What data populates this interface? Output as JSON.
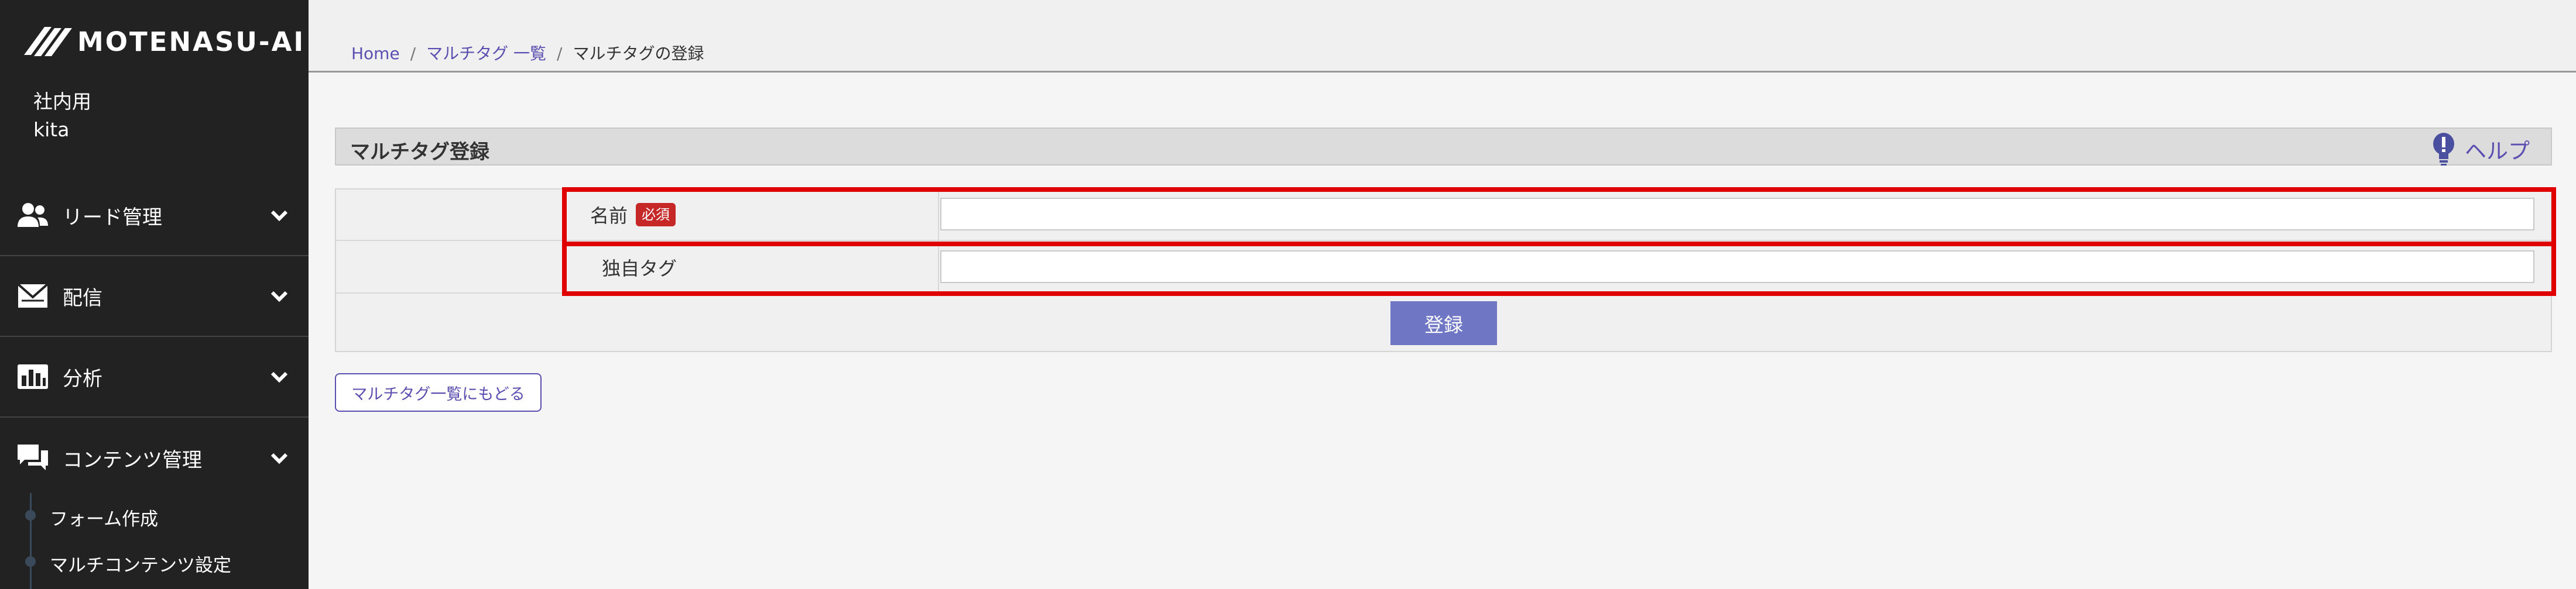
{
  "app": {
    "logo_text": "MOTENASU-AI",
    "user_line1": "社内用",
    "user_line2": "kita"
  },
  "sidebar": {
    "items": [
      {
        "label": "リード管理",
        "icon": "users-icon"
      },
      {
        "label": "配信",
        "icon": "mail-icon"
      },
      {
        "label": "分析",
        "icon": "bar-chart-icon"
      },
      {
        "label": "コンテンツ管理",
        "icon": "chat-icon"
      }
    ],
    "subitems": [
      {
        "label": "フォーム作成"
      },
      {
        "label": "マルチコンテンツ設定"
      }
    ]
  },
  "breadcrumb": {
    "home": "Home",
    "list": "マルチタグ 一覧",
    "current": "マルチタグの登録",
    "sep": "/"
  },
  "section": {
    "title": "マルチタグ登録",
    "help_label": "ヘルプ"
  },
  "form": {
    "name_label": "名前",
    "required_badge": "必須",
    "name_value": "",
    "tag_label": "独自タグ",
    "tag_value": "",
    "submit_label": "登録"
  },
  "back_button": "マルチタグ一覧にもどる",
  "colors": {
    "sidebar_bg": "#222222",
    "accent": "#6f77c5",
    "link": "#5a4fb0",
    "required": "#c62828",
    "highlight": "#e00000"
  }
}
